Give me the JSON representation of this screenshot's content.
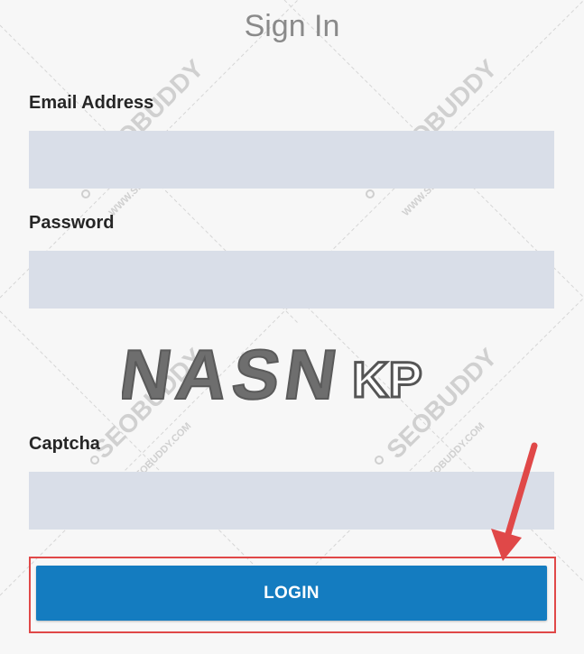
{
  "form": {
    "title": "Sign In",
    "email_label": "Email Address",
    "email_value": "",
    "password_label": "Password",
    "password_value": "",
    "captcha_text": "NASN",
    "captcha_suffix": "KP",
    "captcha_label": "Captcha",
    "captcha_value": "",
    "login_label": "LOGIN"
  },
  "watermark": {
    "brand": "SEOBUDDY",
    "site": "WWW.SEOBUDDY.COM"
  },
  "colors": {
    "accent": "#147cc0",
    "highlight": "#e04848",
    "field_bg": "#d9dee8"
  }
}
